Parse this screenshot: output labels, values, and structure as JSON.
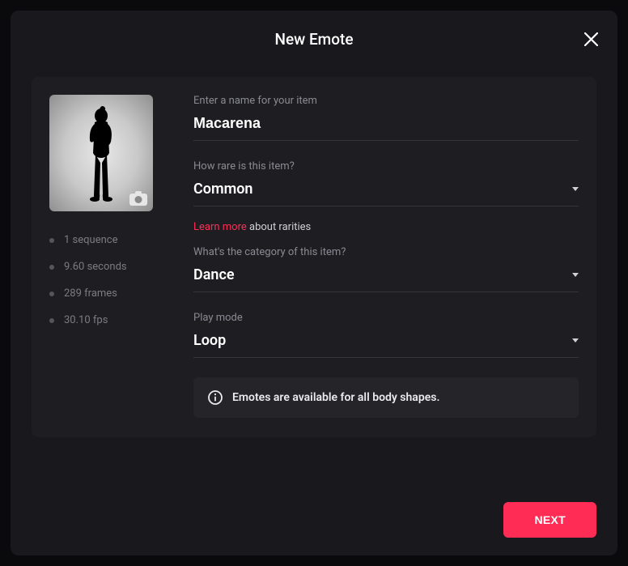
{
  "modal": {
    "title": "New Emote",
    "close_label": "Close"
  },
  "thumb": {
    "camera_icon_name": "camera-icon"
  },
  "meta": [
    "1 sequence",
    "9.60 seconds",
    "289 frames",
    "30.10 fps"
  ],
  "fields": {
    "name": {
      "label": "Enter a name for your item",
      "value": "Macarena"
    },
    "rarity": {
      "label": "How rare is this item?",
      "value": "Common",
      "learn_more": "Learn more",
      "learn_suffix": " about rarities"
    },
    "category": {
      "label": "What's the category of this item?",
      "value": "Dance"
    },
    "play_mode": {
      "label": "Play mode",
      "value": "Loop"
    }
  },
  "banner": {
    "text": "Emotes are available for all body shapes."
  },
  "footer": {
    "next": "NEXT"
  }
}
